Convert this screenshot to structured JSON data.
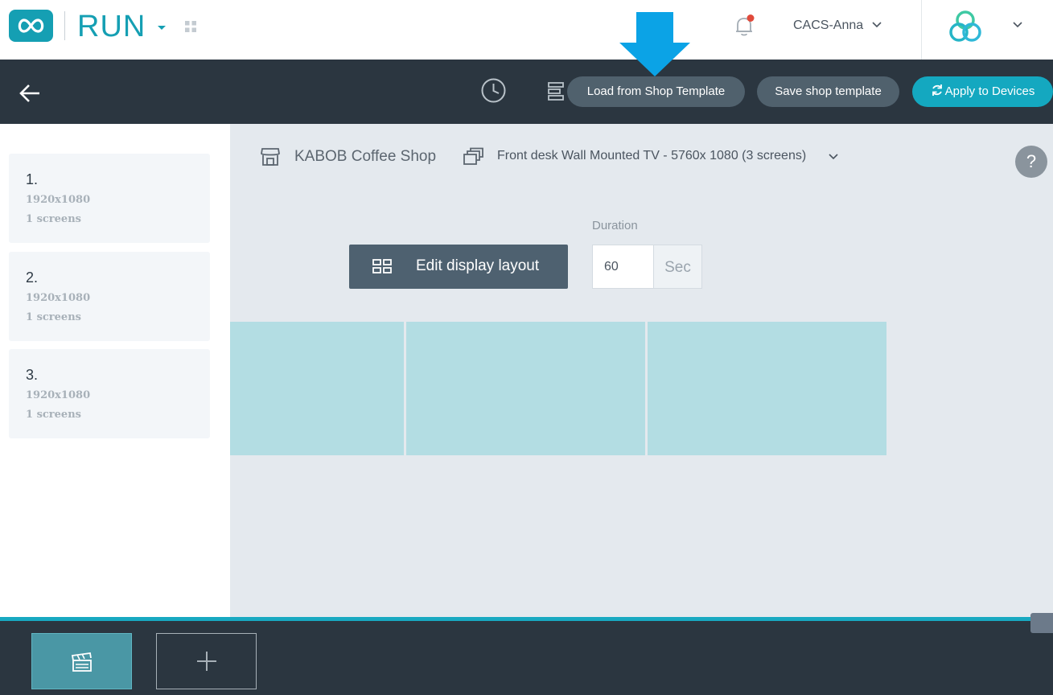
{
  "app": {
    "brand": "RUN",
    "logo_icon": "infinity-logo-icon",
    "user": "CACS-Anna",
    "accent_color": "#159fb3"
  },
  "toolbar": {
    "load_template_label": "Load from Shop Template",
    "save_template_label": "Save shop template",
    "apply_label": "Apply to Devices"
  },
  "screens": [
    {
      "number": "1.",
      "resolution": "1920x1080",
      "count": "1 screens"
    },
    {
      "number": "2.",
      "resolution": "1920x1080",
      "count": "1 screens"
    },
    {
      "number": "3.",
      "resolution": "1920x1080",
      "count": "1 screens"
    }
  ],
  "main": {
    "shop_name": "KABOB Coffee Shop",
    "display_name": "Front desk Wall Mounted TV - 5760x 1080 (3 screens)",
    "help_label": "?",
    "edit_layout_label": "Edit display layout",
    "duration_label": "Duration",
    "duration_value": "60",
    "duration_unit": "Sec"
  },
  "bottom": {
    "add_icon": "plus-icon",
    "scene_icon": "clapperboard-icon"
  }
}
